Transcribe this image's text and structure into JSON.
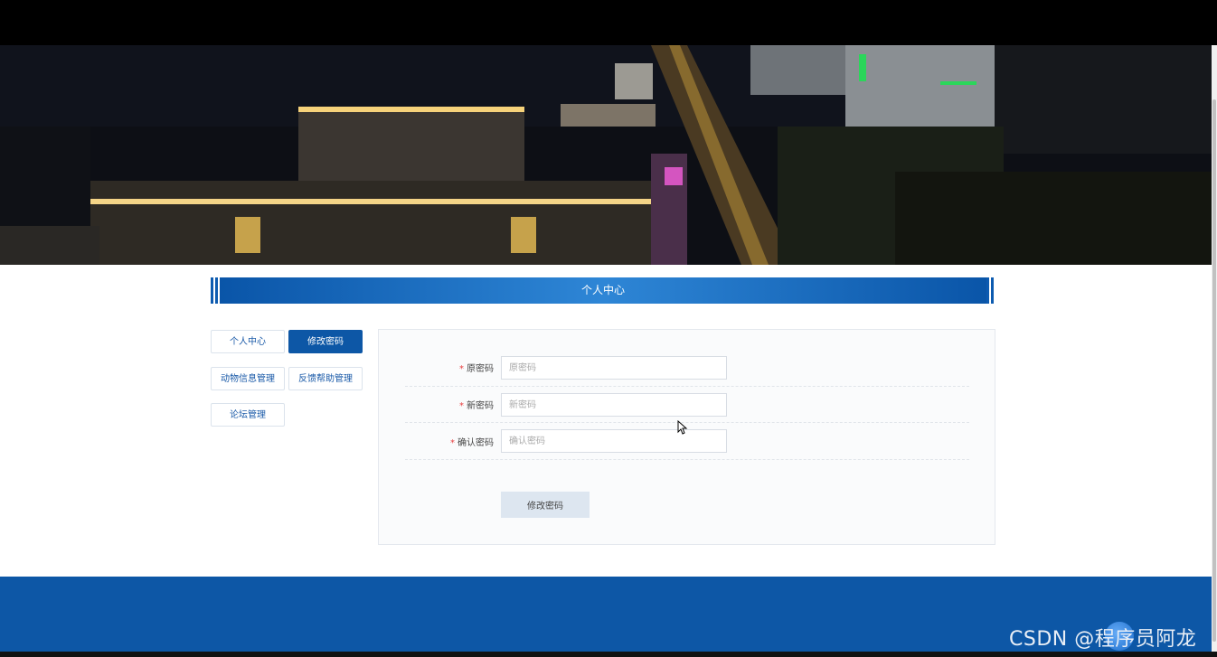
{
  "header": {
    "title": "个人中心"
  },
  "menu": {
    "items": [
      {
        "label": "个人中心"
      },
      {
        "label": "修改密码"
      },
      {
        "label": "动物信息管理"
      },
      {
        "label": "反馈帮助管理"
      },
      {
        "label": "论坛管理"
      }
    ],
    "active_index": 1
  },
  "form": {
    "old_password": {
      "label": "原密码",
      "placeholder": "原密码",
      "value": ""
    },
    "new_password": {
      "label": "新密码",
      "placeholder": "新密码",
      "value": ""
    },
    "confirm_password": {
      "label": "确认密码",
      "placeholder": "确认密码",
      "value": ""
    },
    "required_mark": "*",
    "submit_label": "修改密码"
  },
  "watermark": {
    "text": "CSDN @程序员阿龙"
  },
  "colors": {
    "primary": "#0d57a6",
    "required": "#e84141",
    "submit_bg": "#dde6f0"
  }
}
